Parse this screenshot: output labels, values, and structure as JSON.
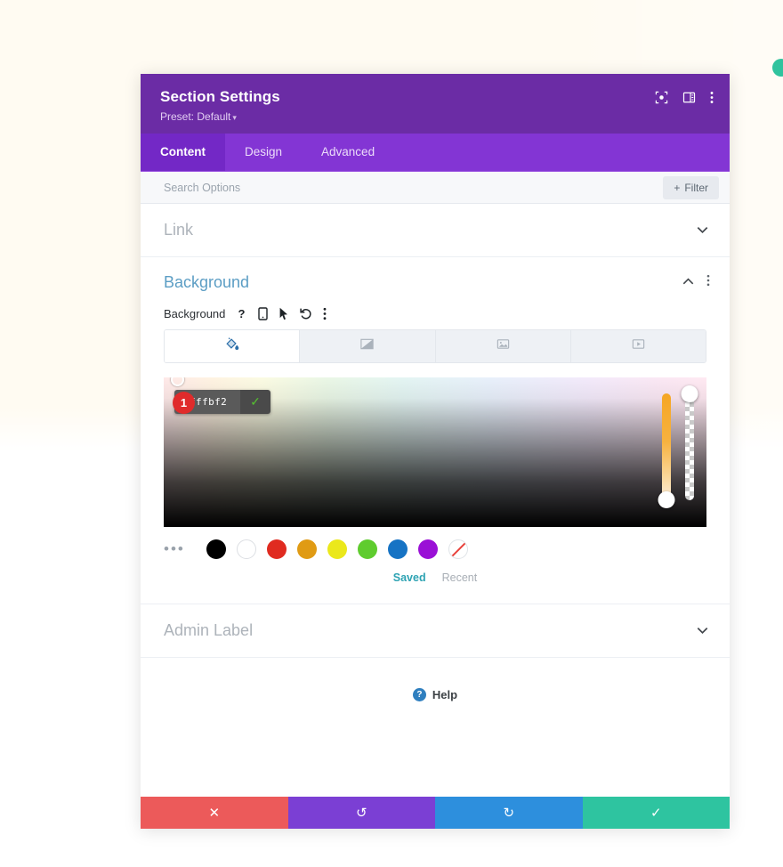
{
  "window": {
    "title": "Section Settings",
    "preset_label": "Preset: Default",
    "caret": "▾",
    "header_icons": [
      {
        "name": "focus-icon"
      },
      {
        "name": "layout-panel-icon"
      },
      {
        "name": "more-vertical-icon"
      }
    ]
  },
  "tabs": [
    {
      "label": "Content",
      "active": true
    },
    {
      "label": "Design",
      "active": false
    },
    {
      "label": "Advanced",
      "active": false
    }
  ],
  "search": {
    "placeholder": "Search Options",
    "value": "",
    "filter_label": "Filter",
    "filter_plus": "+"
  },
  "accordions": {
    "link": {
      "label": "Link",
      "chevron": "⌄"
    },
    "admin_label": {
      "label": "Admin Label",
      "chevron": "⌄"
    }
  },
  "background_section": {
    "title": "Background",
    "collapse_chevron": "⌃",
    "more_icon": "⋮",
    "field_label": "Background",
    "field_icons": [
      "help-icon",
      "responsive-mobile-icon",
      "hover-cursor-icon",
      "reset-undo-icon",
      "more-options-icon"
    ],
    "type_tabs": [
      {
        "name": "background-color-tab",
        "icon": "paint-bucket-icon",
        "active": true
      },
      {
        "name": "background-gradient-tab",
        "icon": "gradient-icon",
        "active": false
      },
      {
        "name": "background-image-tab",
        "icon": "image-icon",
        "active": false
      },
      {
        "name": "background-video-tab",
        "icon": "video-icon",
        "active": false
      }
    ],
    "color_picker": {
      "hex_value": "#fffbf2",
      "confirm_icon": "✓",
      "marker_number": "1",
      "hue_slider_name": "hue-slider",
      "alpha_slider_name": "alpha-slider"
    },
    "swatches": [
      {
        "name": "swatch-black",
        "color": "#000000"
      },
      {
        "name": "swatch-white",
        "color": "#ffffff"
      },
      {
        "name": "swatch-red",
        "color": "#e02b20"
      },
      {
        "name": "swatch-orange",
        "color": "#e09b14"
      },
      {
        "name": "swatch-yellow",
        "color": "#ebe81b"
      },
      {
        "name": "swatch-green",
        "color": "#5fc party"
      },
      {
        "name": "swatch-blue",
        "color": "#1673c4"
      },
      {
        "name": "swatch-purple",
        "color": "#9a10d6"
      },
      {
        "name": "swatch-transparent",
        "color": "none"
      }
    ],
    "swatch_tabs": [
      {
        "label": "Saved",
        "active": true
      },
      {
        "label": "Recent",
        "active": false
      }
    ],
    "more_swatches_icon": "•••"
  },
  "help": {
    "badge": "?",
    "label": "Help"
  },
  "footer_buttons": [
    {
      "name": "cancel-button",
      "icon": "✕",
      "color": "#ec5a5a"
    },
    {
      "name": "undo-button",
      "icon": "↺",
      "color": "#7b3fd4"
    },
    {
      "name": "redo-button",
      "icon": "↻",
      "color": "#2d8fdd"
    },
    {
      "name": "save-button",
      "icon": "✓",
      "color": "#2ec4a0"
    }
  ],
  "page": {
    "background_color": "#fffbf2",
    "accent_teal": "#30c39e"
  }
}
